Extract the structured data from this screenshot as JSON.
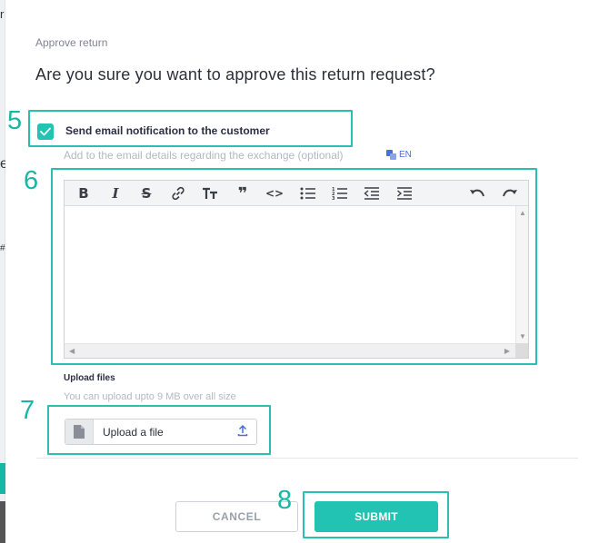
{
  "background": {
    "edge_letters": [
      "r",
      "e",
      "#"
    ]
  },
  "dialog": {
    "label": "Approve return",
    "question": "Are you sure you want to approve this return request?",
    "notify_checkbox": {
      "label": "Send email notification to the customer",
      "checked": true
    },
    "email_details_hint": "Add to the email details regarding the exchange (optional)",
    "language_badge": "EN",
    "editor": {
      "toolbar_icons": [
        "bold-icon",
        "italic-icon",
        "strikethrough-icon",
        "link-icon",
        "heading-icon",
        "quote-icon",
        "code-icon",
        "bullet-list-icon",
        "numbered-list-icon",
        "outdent-icon",
        "indent-icon",
        "undo-icon",
        "redo-icon"
      ],
      "value": ""
    },
    "upload": {
      "title": "Upload files",
      "hint": "You can upload upto 9 MB over all size",
      "button_label": "Upload a file"
    },
    "buttons": {
      "cancel": "CANCEL",
      "submit": "SUBMIT"
    }
  },
  "callouts": {
    "checkbox": "5",
    "editor": "6",
    "upload": "7",
    "submit": "8"
  },
  "colors": {
    "accent": "#22c3b2",
    "callout": "#2bbfb0",
    "link_blue": "#4a6fd6"
  }
}
